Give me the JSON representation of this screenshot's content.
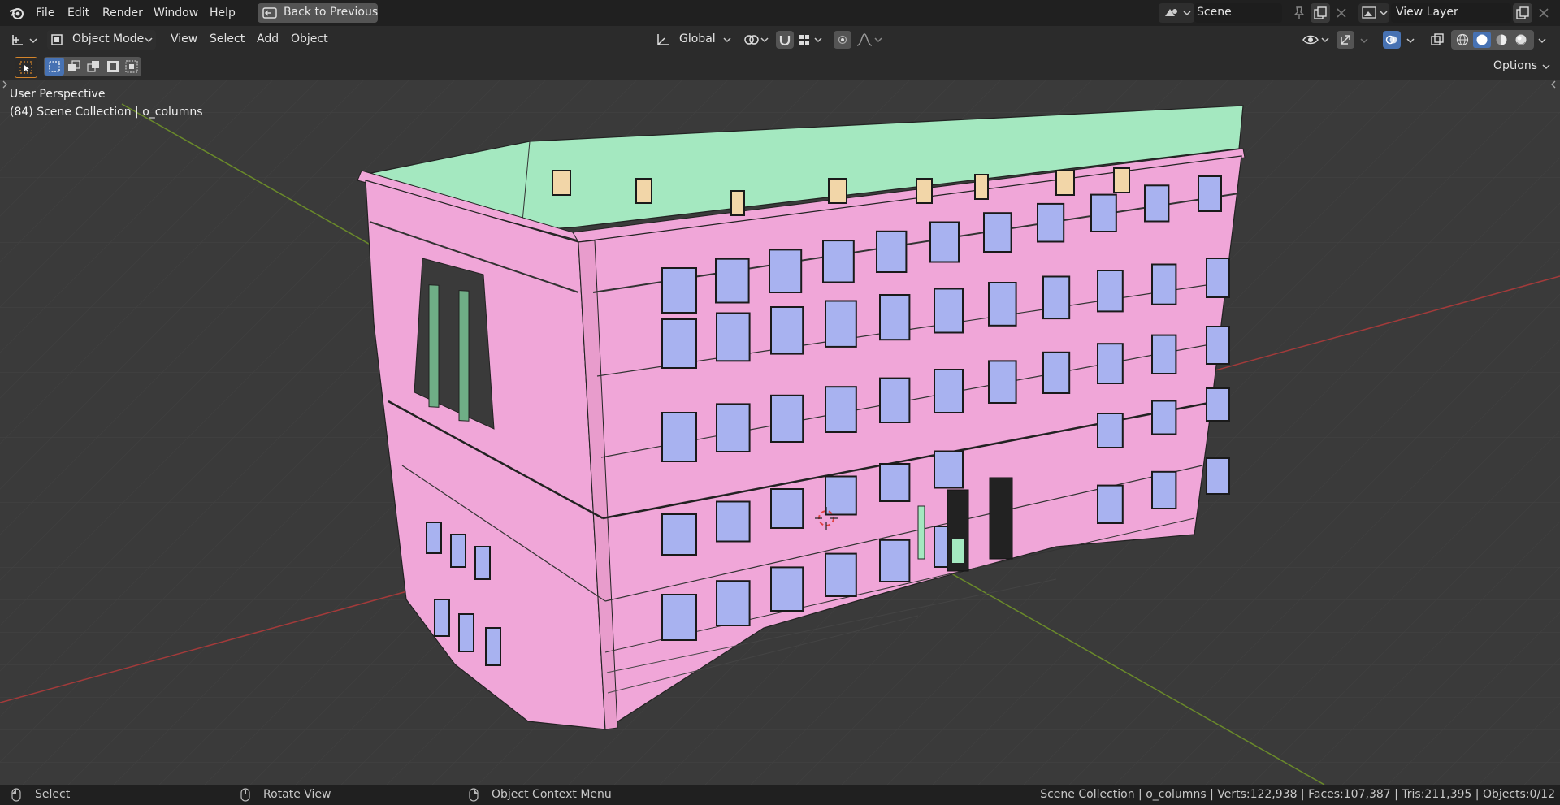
{
  "topbar": {
    "menus": [
      "File",
      "Edit",
      "Render",
      "Window",
      "Help"
    ],
    "back_button": "Back to Previous",
    "scene": "Scene",
    "view_layer": "View Layer"
  },
  "header": {
    "mode": "Object Mode",
    "menus": [
      "View",
      "Select",
      "Add",
      "Object"
    ],
    "transform_orientation": "Global",
    "options": "Options"
  },
  "viewport": {
    "perspective": "User Perspective",
    "collection": "(84) Scene Collection | o_columns"
  },
  "statusbar": {
    "select": "Select",
    "rotate": "Rotate View",
    "context": "Object Context Menu",
    "stats": "Scene Collection | o_columns | Verts:122,938 | Faces:107,387 | Tris:211,395 | Objects:0/12"
  },
  "colors": {
    "wall": "#f0a6d8",
    "roof": "#a4e8c0",
    "window": "#a8b2f0",
    "chimney": "#f2d6a8",
    "grid_x": "#a33a3a",
    "grid_y": "#6a8a2a"
  },
  "icons": [
    "blender-logo-icon",
    "back-icon",
    "editor-type-icon",
    "object-mode-icon",
    "orientation-icon",
    "pivot-icon",
    "snap-icon",
    "snap-target-icon",
    "proportional-icon",
    "falloff-icon",
    "visibility-icon",
    "gizmo-icon",
    "overlay-icon",
    "xray-icon",
    "wireframe-shading-icon",
    "solid-shading-icon",
    "material-shading-icon",
    "rendered-shading-icon",
    "scene-icon",
    "pin-icon",
    "new-scene-icon",
    "delete-icon",
    "view-layer-icon",
    "new-layer-icon",
    "select-box-icon",
    "mouse-left-icon",
    "mouse-middle-icon",
    "mouse-right-icon"
  ]
}
